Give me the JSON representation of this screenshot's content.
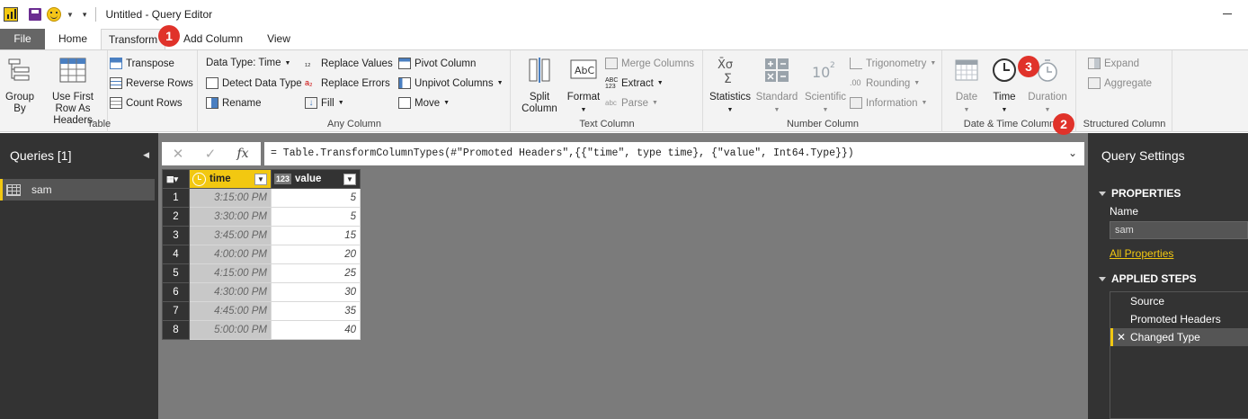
{
  "window": {
    "title": "Untitled - Query Editor"
  },
  "tabs": [
    {
      "label": "File"
    },
    {
      "label": "Home"
    },
    {
      "label": "Transform"
    },
    {
      "label": "Add Column"
    },
    {
      "label": "View"
    }
  ],
  "ribbon": {
    "table": {
      "label": "Table",
      "group_by": "Group By",
      "use_first_row": "Use First Row As Headers",
      "transpose": "Transpose",
      "reverse_rows": "Reverse Rows",
      "count_rows": "Count Rows"
    },
    "any_column": {
      "label": "Any Column",
      "data_type": "Data Type: Time",
      "detect": "Detect Data Type",
      "rename": "Rename",
      "replace_values": "Replace Values",
      "replace_errors": "Replace Errors",
      "fill": "Fill",
      "pivot": "Pivot Column",
      "unpivot": "Unpivot Columns",
      "move": "Move"
    },
    "text_column": {
      "label": "Text Column",
      "split": "Split Column",
      "format": "Format",
      "merge": "Merge Columns",
      "extract": "Extract",
      "parse": "Parse"
    },
    "number_column": {
      "label": "Number Column",
      "statistics": "Statistics",
      "standard": "Standard",
      "scientific": "Scientific",
      "trig": "Trigonometry",
      "rounding": "Rounding",
      "information": "Information"
    },
    "datetime": {
      "label": "Date & Time Column",
      "date": "Date",
      "time": "Time",
      "duration": "Duration"
    },
    "structured": {
      "label": "Structured Column",
      "expand": "Expand",
      "aggregate": "Aggregate"
    }
  },
  "left_pane": {
    "title": "Queries [1]",
    "items": [
      {
        "label": "sam"
      }
    ]
  },
  "formula_bar": {
    "cancel": "✕",
    "commit": "✓",
    "fx": "fx",
    "formula": "= Table.TransformColumnTypes(#\"Promoted Headers\",{{\"time\", type time}, {\"value\", Int64.Type}})"
  },
  "grid": {
    "columns": [
      {
        "name": "time",
        "type_icon": "clock-icon"
      },
      {
        "name": "value",
        "type_icon": "123"
      }
    ],
    "rows": [
      {
        "n": "1",
        "time": "3:15:00 PM",
        "value": "5"
      },
      {
        "n": "2",
        "time": "3:30:00 PM",
        "value": "5"
      },
      {
        "n": "3",
        "time": "3:45:00 PM",
        "value": "15"
      },
      {
        "n": "4",
        "time": "4:00:00 PM",
        "value": "20"
      },
      {
        "n": "5",
        "time": "4:15:00 PM",
        "value": "25"
      },
      {
        "n": "6",
        "time": "4:30:00 PM",
        "value": "30"
      },
      {
        "n": "7",
        "time": "4:45:00 PM",
        "value": "35"
      },
      {
        "n": "8",
        "time": "5:00:00 PM",
        "value": "40"
      }
    ]
  },
  "right_pane": {
    "title": "Query Settings",
    "properties_header": "PROPERTIES",
    "name_label": "Name",
    "name_value": "sam",
    "all_properties": "All Properties",
    "steps_header": "APPLIED STEPS",
    "steps": [
      {
        "label": "Source"
      },
      {
        "label": "Promoted Headers"
      },
      {
        "label": "Changed Type"
      }
    ]
  },
  "callouts": [
    "1",
    "2",
    "3"
  ],
  "colors": {
    "accent": "#f2c811",
    "callout": "#e0322a",
    "pane": "#333333"
  }
}
